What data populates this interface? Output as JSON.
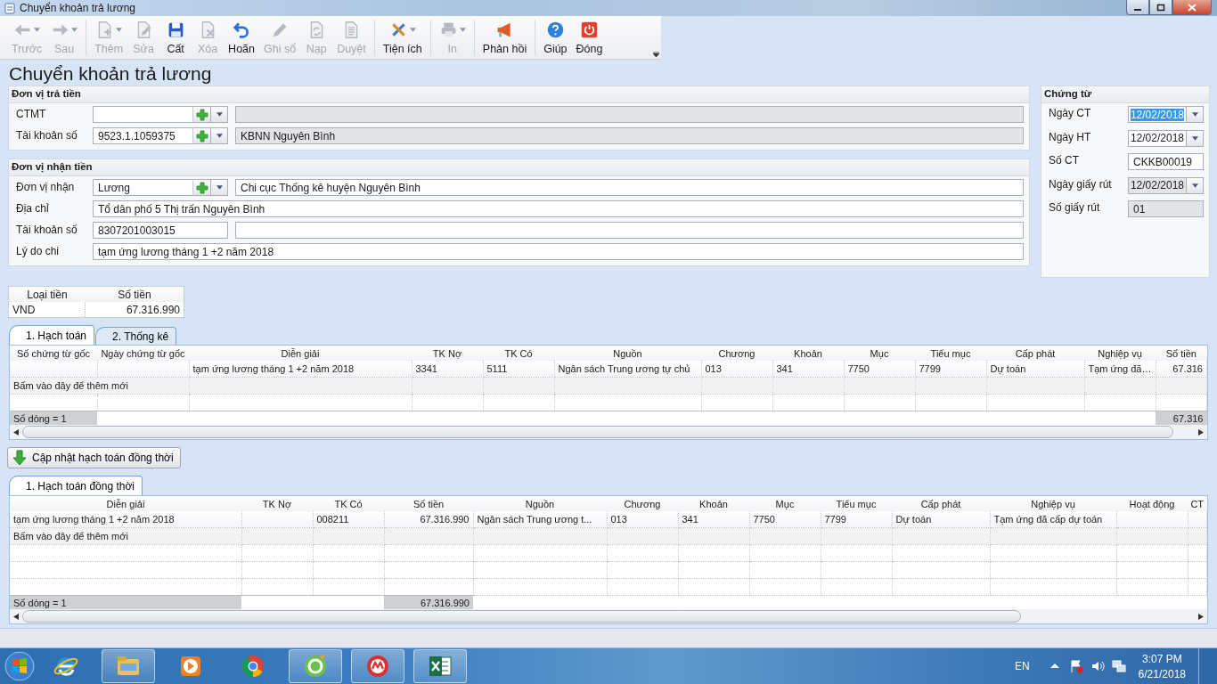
{
  "window": {
    "title": "Chuyển khoản trả lương"
  },
  "toolbar": {
    "groups": [
      {
        "items": [
          {
            "label": "Trước",
            "kind": "back",
            "disabled": true,
            "has_menu": true
          },
          {
            "label": "Sau",
            "kind": "forward",
            "disabled": true,
            "has_menu": true
          }
        ]
      },
      {
        "items": [
          {
            "label": "Thêm",
            "kind": "add",
            "disabled": true,
            "has_menu": true
          },
          {
            "label": "Sửa",
            "kind": "edit",
            "disabled": true,
            "has_menu": false
          },
          {
            "label": "Cất",
            "kind": "save",
            "disabled": false,
            "has_menu": false
          },
          {
            "label": "Xóa",
            "kind": "delete",
            "disabled": true,
            "has_menu": false
          },
          {
            "label": "Hoãn",
            "kind": "undo",
            "disabled": false,
            "has_menu": false
          },
          {
            "label": "Ghi sổ",
            "kind": "post",
            "disabled": true,
            "has_menu": false
          },
          {
            "label": "Nạp",
            "kind": "reload",
            "disabled": true,
            "has_menu": false
          },
          {
            "label": "Duyệt",
            "kind": "approve",
            "disabled": true,
            "has_menu": false
          }
        ]
      },
      {
        "items": [
          {
            "label": "Tiện ích",
            "kind": "tools",
            "disabled": false,
            "has_menu": true
          }
        ]
      },
      {
        "items": [
          {
            "label": "In",
            "kind": "print",
            "disabled": true,
            "has_menu": true
          }
        ]
      },
      {
        "items": [
          {
            "label": "Phản hồi",
            "kind": "feedback",
            "disabled": false,
            "has_menu": false
          }
        ]
      },
      {
        "items": [
          {
            "label": "Giúp",
            "kind": "help",
            "disabled": false,
            "has_menu": false
          },
          {
            "label": "Đóng",
            "kind": "close",
            "disabled": false,
            "has_menu": false
          }
        ]
      }
    ]
  },
  "heading": "Chuyển khoản trả lương",
  "payer": {
    "title": "Đơn vị trả tiền",
    "rows": [
      {
        "label": "CTMT",
        "kind": "combo",
        "detail_readonly": true
      },
      {
        "label": "Tài khoản số",
        "kind": "combo",
        "value": "9523.1.1059375",
        "detail": "KBNN Nguyên Bình",
        "detail_readonly": true
      }
    ]
  },
  "payee": {
    "title": "Đơn vị nhận tiền",
    "rows": [
      {
        "label": "Đơn vị nhận",
        "kind": "combo",
        "value": "Lương",
        "detail": "Chi cục Thống kê huyện Nguyên Bình",
        "detail_readonly": false
      },
      {
        "label": "Địa chỉ",
        "kind": "text",
        "value": "Tổ dân phố 5 Thị trấn Nguyên Bình"
      },
      {
        "label": "Tài khoản số",
        "kind": "pair",
        "value": "8307201003015",
        "detail_readonly": false
      },
      {
        "label": "Lý do chi",
        "kind": "text",
        "value": "tạm ứng lương tháng 1 +2 năm 2018"
      }
    ]
  },
  "voucher": {
    "title": "Chứng từ",
    "fields": [
      {
        "label": "Ngày CT",
        "kind": "date",
        "value": "12/02/2018",
        "selected": true,
        "readonly": false
      },
      {
        "label": "Ngày HT",
        "kind": "date",
        "value": "12/02/2018",
        "selected": false,
        "readonly": false
      },
      {
        "label": "Số CT",
        "kind": "text",
        "value": "CKKB00019",
        "selected": false,
        "readonly": false
      },
      {
        "label": "Ngày giấy rút",
        "kind": "date",
        "value": "12/02/2018",
        "selected": false,
        "readonly": true
      },
      {
        "label": "Số giấy rút",
        "kind": "text",
        "value": "01",
        "selected": false,
        "readonly": true
      }
    ]
  },
  "currency": {
    "columns": [
      "Loại tiền",
      "Số tiền"
    ],
    "rows": [
      [
        "VND",
        "67.316.990"
      ]
    ]
  },
  "ledger": {
    "tabs": [
      {
        "label": "1. Hạch toán",
        "selected": true
      },
      {
        "label": "2. Thống kê",
        "selected": false
      }
    ],
    "columns": [
      "Số chứng từ gốc",
      "Ngày chứng từ gốc",
      "Diễn giải",
      "TK Nợ",
      "TK Có",
      "Nguồn",
      "Chương",
      "Khoản",
      "Mục",
      "Tiểu mục",
      "Cấp phát",
      "Nghiệp vụ",
      "Số tiền"
    ],
    "rows": [
      [
        null,
        null,
        "tạm ứng lương tháng 1 +2 năm 2018",
        "3341",
        "5111",
        "Ngân sách Trung ương tự chủ",
        "013",
        "341",
        "7750",
        "7799",
        "Dự toán",
        "Tạm ứng đã…",
        "67.316"
      ]
    ],
    "new_row": "Bấm vào đây để thêm mới",
    "footer": {
      "count": "Số dòng = 1",
      "total": "67.316"
    }
  },
  "update_button": {
    "label": "Cập nhật hạch toán đồng thời"
  },
  "concurrent": {
    "tabs": [
      {
        "label": "1. Hạch toán đồng thời",
        "selected": true
      }
    ],
    "columns": [
      "Diễn giải",
      "TK Nợ",
      "TK Có",
      "Số tiền",
      "Nguồn",
      "Chương",
      "Khoản",
      "Mục",
      "Tiểu mục",
      "Cấp phát",
      "Nghiệp vụ",
      "Hoạt động",
      "CT"
    ],
    "rows": [
      [
        "tạm ứng lương tháng 1 +2 năm 2018",
        null,
        "008211",
        "67.316.990",
        "Ngân sách Trung ương t...",
        "013",
        "341",
        "7750",
        "7799",
        "Dự toán",
        "Tạm ứng đã cấp dự toán",
        null,
        null
      ]
    ],
    "new_row": "Bấm vào đây để thêm mới",
    "footer": {
      "count": "Số dòng = 1",
      "total": "67.316.990"
    }
  },
  "taskbar": {
    "apps": [
      {
        "kind": "ie",
        "running": false
      },
      {
        "kind": "explorer",
        "running": true
      },
      {
        "kind": "media",
        "running": false
      },
      {
        "kind": "chrome",
        "running": false
      },
      {
        "kind": "green-app",
        "running": true
      },
      {
        "kind": "red-app",
        "running": true
      },
      {
        "kind": "excel",
        "running": true
      }
    ],
    "tray": {
      "language": "EN",
      "time": "3:07 PM",
      "date": "6/21/2018"
    }
  }
}
